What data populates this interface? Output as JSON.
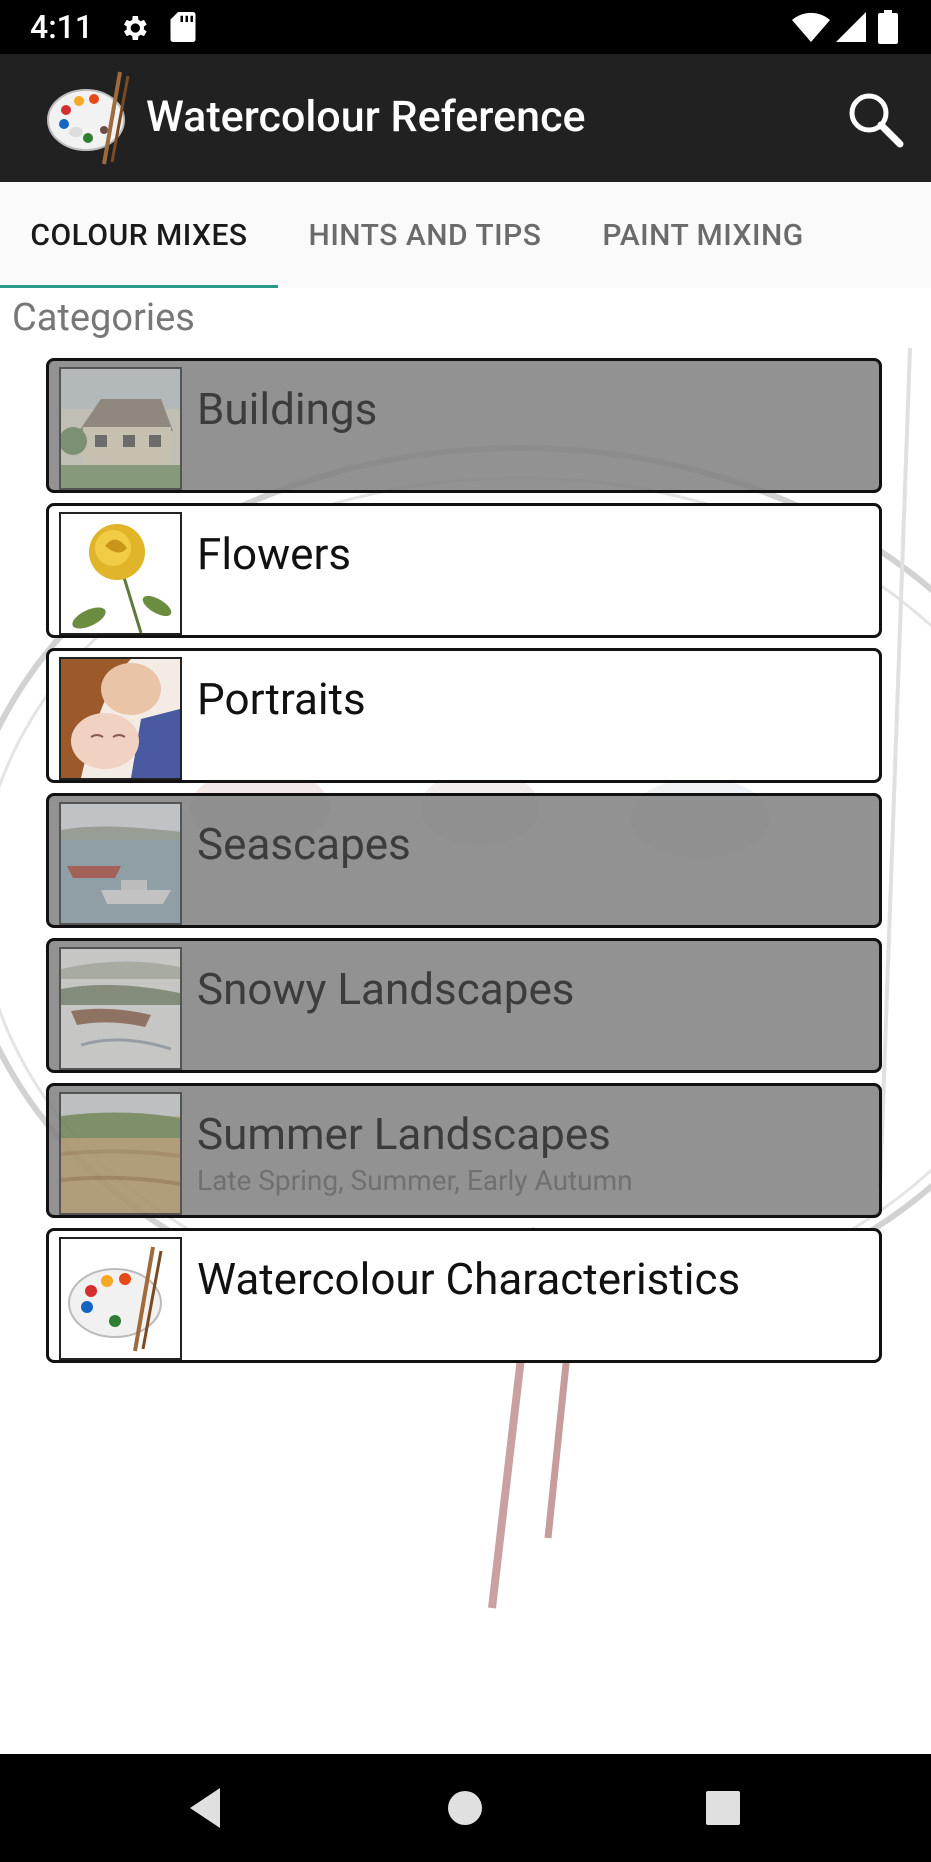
{
  "status_bar": {
    "time": "4:11"
  },
  "app_bar": {
    "title": "Watercolour Reference"
  },
  "tabs": [
    {
      "label": "COLOUR MIXES",
      "active": true
    },
    {
      "label": "HINTS AND TIPS",
      "active": false
    },
    {
      "label": "PAINT MIXING",
      "active": false
    }
  ],
  "section": {
    "title": "Categories"
  },
  "categories": [
    {
      "name": "Buildings",
      "subtitle": "",
      "enabled": false
    },
    {
      "name": "Flowers",
      "subtitle": "",
      "enabled": true
    },
    {
      "name": "Portraits",
      "subtitle": "",
      "enabled": true
    },
    {
      "name": "Seascapes",
      "subtitle": "",
      "enabled": false
    },
    {
      "name": "Snowy Landscapes",
      "subtitle": "",
      "enabled": false
    },
    {
      "name": "Summer Landscapes",
      "subtitle": "Late Spring, Summer, Early Autumn",
      "enabled": false
    },
    {
      "name": "Watercolour Characteristics",
      "subtitle": "",
      "enabled": true
    }
  ],
  "colors": {
    "tab_indicator": "#2c9a8b",
    "app_bar": "#212121",
    "disabled_overlay": "#808080"
  }
}
